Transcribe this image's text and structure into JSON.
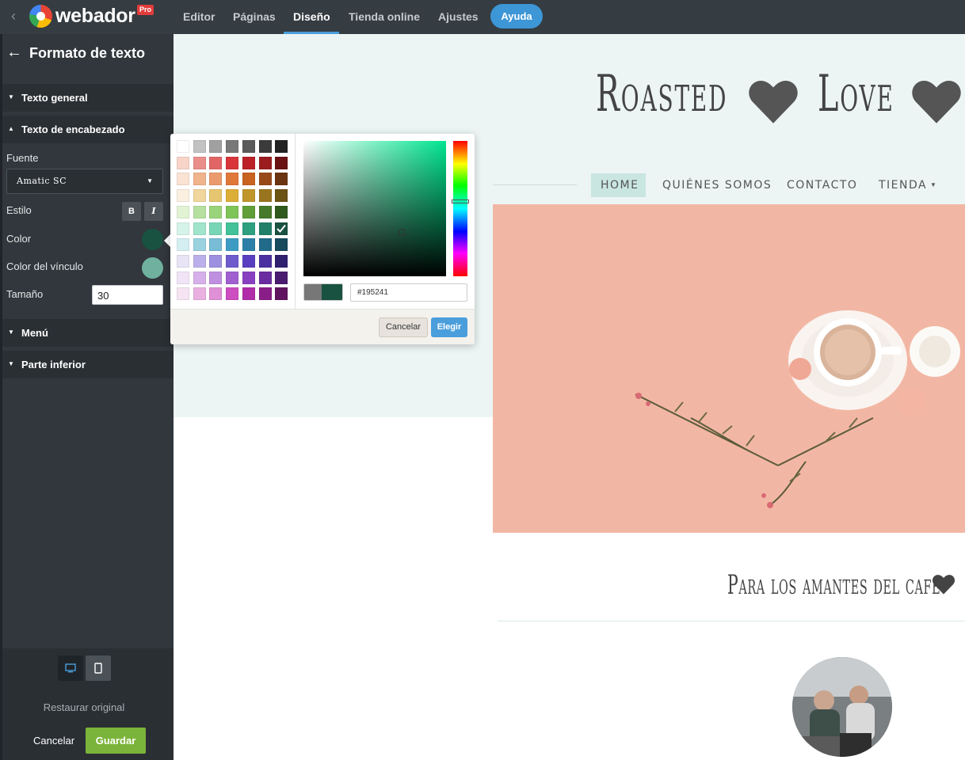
{
  "topbar": {
    "logo_text": "webador",
    "pro_badge": "Pro",
    "nav": [
      "Editor",
      "Páginas",
      "Diseño",
      "Tienda online",
      "Ajustes"
    ],
    "active_nav": "Diseño",
    "help_label": "Ayuda"
  },
  "panel": {
    "title": "Formato de texto",
    "sections": {
      "general_text": "Texto general",
      "heading_text": "Texto de encabezado",
      "menu": "Menú",
      "footer": "Parte inferior"
    },
    "font_label": "Fuente",
    "font_value": "Amatic SC",
    "style_label": "Estilo",
    "bold_label": "B",
    "italic_label": "I",
    "color_label": "Color",
    "color_value": "#195241",
    "link_color_label": "Color del vínculo",
    "link_color_value": "#6fb09e",
    "size_label": "Tamaño",
    "size_value": "30",
    "restore_label": "Restaurar original",
    "cancel_label": "Cancelar",
    "save_label": "Guardar"
  },
  "picker": {
    "hex_value": "#195241",
    "cancel_label": "Cancelar",
    "choose_label": "Elegir",
    "palette": [
      [
        "#ffffff",
        "#c2c2c2",
        "#a0a0a0",
        "#787878",
        "#5b5b5b",
        "#3b3b3b",
        "#222222"
      ],
      [
        "#f8d4c8",
        "#ea8e8a",
        "#e26565",
        "#d8363b",
        "#bb2126",
        "#9a1c1e",
        "#6b1214"
      ],
      [
        "#fbe3d4",
        "#f0b48c",
        "#ea9a6c",
        "#e0783a",
        "#c86320",
        "#98491a",
        "#6b3411"
      ],
      [
        "#fbefe0",
        "#f0d69c",
        "#e6c670",
        "#dcae38",
        "#c0962a",
        "#98751e",
        "#6b5215"
      ],
      [
        "#e2f3d4",
        "#b6e0a0",
        "#9ad47a",
        "#7ec458",
        "#5f9e38",
        "#467a2a",
        "#2f5a1d"
      ],
      [
        "#d6f3ea",
        "#a0e4cc",
        "#78d6b6",
        "#44c29a",
        "#2ea080",
        "#238068",
        "#195241"
      ],
      [
        "#d4eef2",
        "#9ad2e0",
        "#78bcd6",
        "#3e9cc4",
        "#2c80a8",
        "#226a8a",
        "#164a5c"
      ],
      [
        "#e8e4f6",
        "#bcb0ea",
        "#9e90e0",
        "#6e5ccc",
        "#5a40c0",
        "#4a30a0",
        "#302070"
      ],
      [
        "#f0e4f6",
        "#d6b0ea",
        "#c090e0",
        "#a060d0",
        "#8840c0",
        "#6a2ea0",
        "#4a1c70"
      ],
      [
        "#f6e4f2",
        "#eab0e0",
        "#e090d6",
        "#cc4ec0",
        "#b02ca8",
        "#8a1e88",
        "#601460"
      ]
    ],
    "selected": "#195241"
  },
  "site": {
    "title": "Roasted",
    "title2": "Love",
    "menu": [
      "HOME",
      "QUIÉNES SOMOS",
      "CONTACTO",
      "TIENDA"
    ],
    "subtitle": "Para los amantes del café"
  }
}
